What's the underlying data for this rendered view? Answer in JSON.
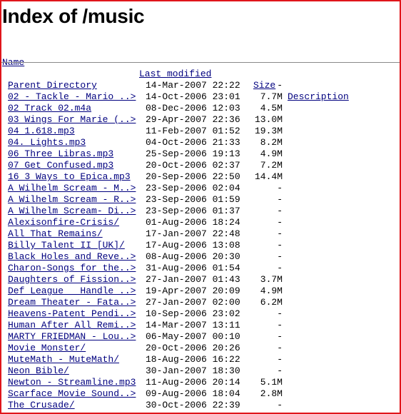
{
  "page": {
    "title": "Index of /music"
  },
  "columns": {
    "name": "Name",
    "last_modified": "Last modified",
    "size": "Size",
    "description": "Description"
  },
  "entries": [
    {
      "name": "Parent Directory",
      "modified": "14-Mar-2007 22:22",
      "size": "-"
    },
    {
      "name": "02 - Tackle - Mario ..>",
      "modified": "14-Oct-2006 23:01",
      "size": "7.7M"
    },
    {
      "name": "02 Track 02.m4a",
      "modified": "08-Dec-2006 12:03",
      "size": "4.5M"
    },
    {
      "name": "03 Wings For Marie (..>",
      "modified": "29-Apr-2007 22:36",
      "size": "13.0M"
    },
    {
      "name": "04 1.618.mp3",
      "modified": "11-Feb-2007 01:52",
      "size": "19.3M"
    },
    {
      "name": "04. Lights.mp3",
      "modified": "04-Oct-2006 21:33",
      "size": "8.2M"
    },
    {
      "name": "06 Three Libras.mp3",
      "modified": "25-Sep-2006 19:13",
      "size": "4.9M"
    },
    {
      "name": "07 Get Confused.mp3",
      "modified": "20-Oct-2006 02:37",
      "size": "7.2M"
    },
    {
      "name": "16 3 Ways to Epica.mp3",
      "modified": "20-Sep-2006 22:50",
      "size": "14.4M"
    },
    {
      "name": "A Wilhelm Scream - M..>",
      "modified": "23-Sep-2006 02:04",
      "size": "-"
    },
    {
      "name": "A Wilhelm Scream - R..>",
      "modified": "23-Sep-2006 01:59",
      "size": "-"
    },
    {
      "name": "A Wilhelm Scream- Di..>",
      "modified": "23-Sep-2006 01:37",
      "size": "-"
    },
    {
      "name": "Alexisonfire-Crisis/",
      "modified": "01-Aug-2006 18:24",
      "size": "-"
    },
    {
      "name": "All That Remains/",
      "modified": "17-Jan-2007 22:48",
      "size": "-"
    },
    {
      "name": "Billy Talent II [UK]/",
      "modified": "17-Aug-2006 13:08",
      "size": "-"
    },
    {
      "name": "Black Holes and Reve..>",
      "modified": "08-Aug-2006 20:30",
      "size": "-"
    },
    {
      "name": "Charon-Songs for the..>",
      "modified": "31-Aug-2006 01:54",
      "size": "-"
    },
    {
      "name": "Daughters of Fission..>",
      "modified": "27-Jan-2007 01:43",
      "size": "3.7M"
    },
    {
      "name": "Def League   Handle ..>",
      "modified": "19-Apr-2007 20:09",
      "size": "4.9M"
    },
    {
      "name": "Dream Theater - Fata..>",
      "modified": "27-Jan-2007 02:00",
      "size": "6.2M"
    },
    {
      "name": "Heavens-Patent Pendi..>",
      "modified": "10-Sep-2006 23:02",
      "size": "-"
    },
    {
      "name": "Human After All Remi..>",
      "modified": "14-Mar-2007 13:11",
      "size": "-"
    },
    {
      "name": "MARTY FRIEDMAN - Lou..>",
      "modified": "06-May-2007 00:10",
      "size": "-"
    },
    {
      "name": "Movie Monster/",
      "modified": "20-Oct-2006 20:26",
      "size": "-"
    },
    {
      "name": "MuteMath - MuteMath/",
      "modified": "18-Aug-2006 16:22",
      "size": "-"
    },
    {
      "name": "Neon Bible/",
      "modified": "30-Jan-2007 18:30",
      "size": "-"
    },
    {
      "name": "Newton - Streamline.mp3",
      "modified": "11-Aug-2006 20:14",
      "size": "5.1M"
    },
    {
      "name": "Scarface Movie Sound..>",
      "modified": "09-Aug-2006 18:04",
      "size": "2.8M"
    },
    {
      "name": "The Crusade/",
      "modified": "30-Oct-2006 22:39",
      "size": "-"
    }
  ]
}
